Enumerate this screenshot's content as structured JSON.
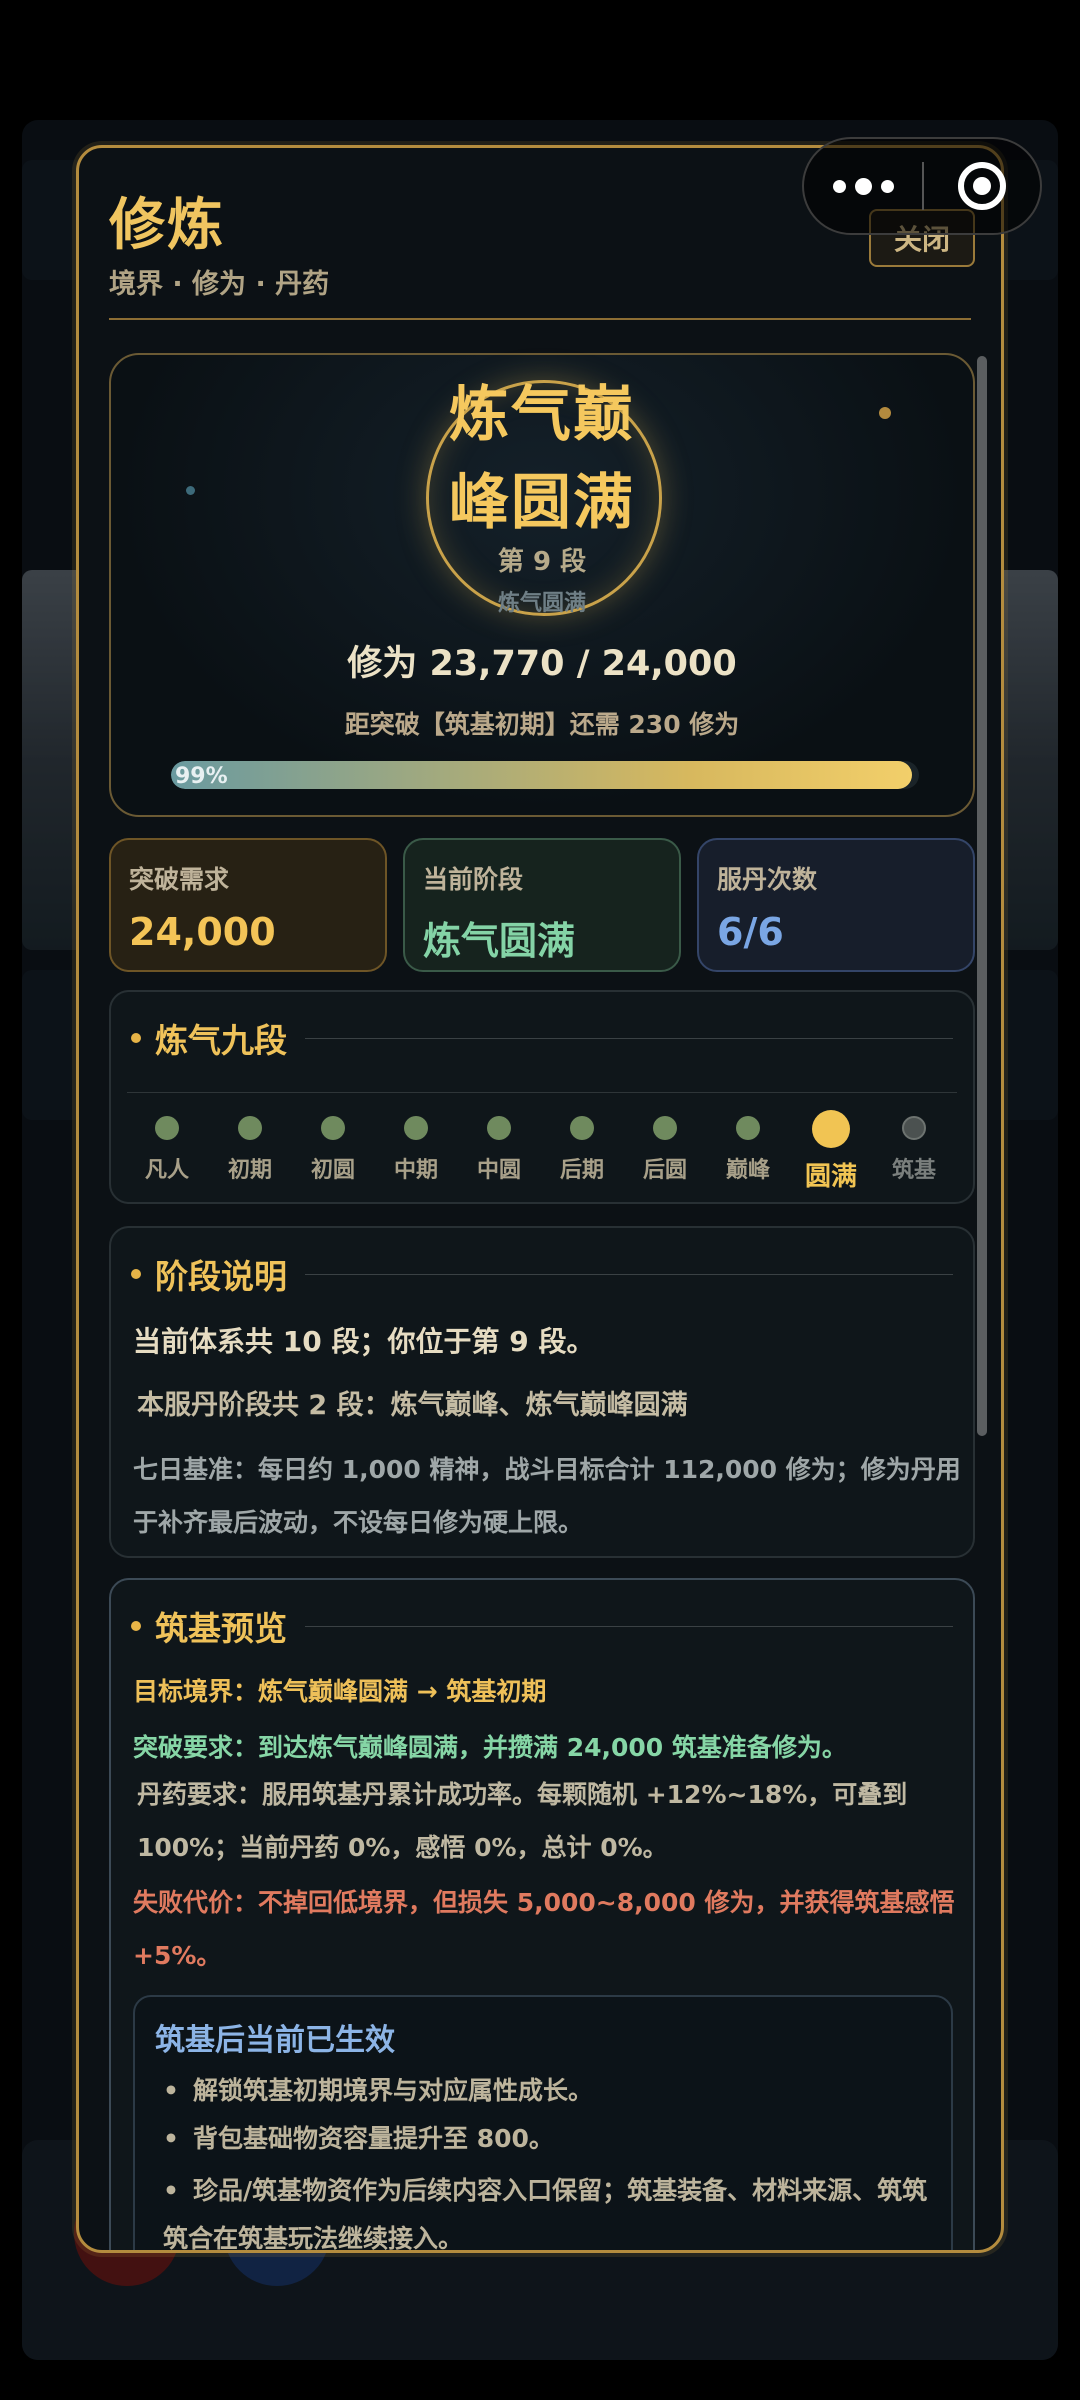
{
  "modal": {
    "title": "修炼",
    "subtitle": "境界 · 修为 · 丹药",
    "close_label": "关闭"
  },
  "realm": {
    "name_line1": "炼气巅",
    "name_line2": "峰圆满",
    "stage": "第 9 段",
    "sub": "炼气圆满",
    "cultivation": "修为 23,770 / 24,000",
    "hint": "距突破【筑基初期】还需 230 修为",
    "progress_label": "99%",
    "progress_fraction": 0.99
  },
  "stats": [
    {
      "key": "突破需求",
      "value": "24,000"
    },
    {
      "key": "当前阶段",
      "value": "炼气圆满"
    },
    {
      "key": "服丹次数",
      "value": "6/6"
    }
  ],
  "stages_section": {
    "title": "炼气九段",
    "stages": [
      "凡人",
      "初期",
      "初圆",
      "中期",
      "中圆",
      "后期",
      "后圆",
      "巅峰",
      "圆满",
      "筑基"
    ],
    "current_index": 8
  },
  "desc_section": {
    "title": "阶段说明",
    "line1": "当前体系共 10 段；你位于第 9 段。",
    "line2": "本服丹阶段共 2 段：炼气巅峰、炼气巅峰圆满",
    "line3": "七日基准：每日约 1,000 精神，战斗目标合计 112,000 修为；修为丹用于补齐最后波动，不设每日修为硬上限。"
  },
  "preview_section": {
    "title": "筑基预览",
    "target": "目标境界：炼气巅峰圆满 → 筑基初期",
    "requirement": "突破要求：到达炼气巅峰圆满，并攒满 24,000 筑基准备修为。",
    "pill": "丹药要求：服用筑基丹累计成功率。每颗随机 +12%~18%，可叠到100%；当前丹药 0%，感悟 0%，总计 0%。",
    "failure": "失败代价：不掉回低境界，但损失 5,000~8,000 修为，并获得筑基感悟 +5%。",
    "effects_title": "筑基后当前已生效",
    "effects": [
      "解锁筑基初期境界与对应属性成长。",
      "背包基础物资容量提升至 800。",
      "珍品/筑基物资作为后续内容入口保留；筑基装备、材料来源、筑筑筑合在筑基玩法继续接入。"
    ]
  },
  "colors": {
    "gold": "#f0c560",
    "green": "#84d3a6",
    "blue": "#7aa6e4",
    "red": "#e07a5f"
  }
}
